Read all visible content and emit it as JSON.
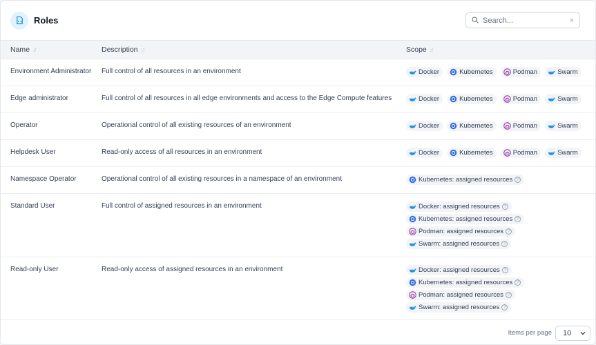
{
  "header": {
    "title": "Roles",
    "search_placeholder": "Search...",
    "clear": "×"
  },
  "columns": {
    "name": "Name",
    "description": "Description",
    "scope": "Scope",
    "sort_glyph": "↓↑"
  },
  "scope_labels": {
    "docker": "Docker",
    "kubernetes": "Kubernetes",
    "podman": "Podman",
    "swarm": "Swarm",
    "docker_assigned": "Docker: assigned resources",
    "kubernetes_assigned": "Kubernetes: assigned resources",
    "podman_assigned": "Podman: assigned resources",
    "swarm_assigned": "Swarm: assigned resources",
    "help_glyph": "?"
  },
  "rows": [
    {
      "name": "Environment Administrator",
      "description": "Full control of all resources in an environment"
    },
    {
      "name": "Edge administrator",
      "description": "Full control of all resources in all edge environments and access to the Edge Compute features"
    },
    {
      "name": "Operator",
      "description": "Operational control of all existing resources of an environment"
    },
    {
      "name": "Helpdesk User",
      "description": "Read-only access of all resources in an environment"
    },
    {
      "name": "Namespace Operator",
      "description": "Operational control of all existing resources in a namespace of an environment"
    },
    {
      "name": "Standard User",
      "description": "Full control of assigned resources in an environment"
    },
    {
      "name": "Read-only User",
      "description": "Read-only access of assigned resources in an environment"
    }
  ],
  "footer": {
    "items_per_page_label": "Items per page",
    "items_per_page_value": "10",
    "chevron": "⌄"
  },
  "colors": {
    "docker": "#1d91e6",
    "kubernetes": "#326ce5",
    "podman": "#892ca0",
    "accent_bg": "#e0f2fe"
  }
}
